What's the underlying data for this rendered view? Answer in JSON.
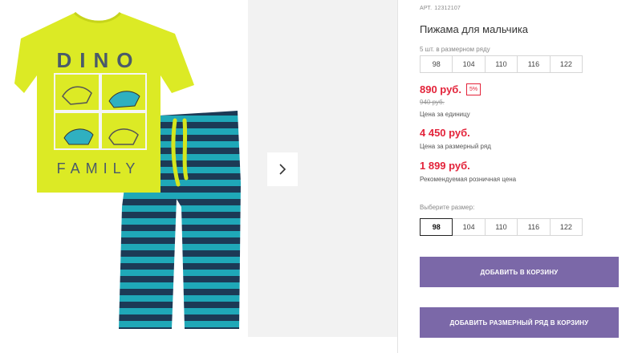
{
  "product": {
    "article_label": "АРТ.",
    "article": "12312107",
    "title": "Пижама для мальчика"
  },
  "gallery": {
    "shirt_print_top": "DINO",
    "shirt_print_bottom": "FAMILY",
    "next_icon": "chevron-right-icon",
    "shirt_color": "#dcea25",
    "stripe_dark": "#1c3a56",
    "stripe_light": "#1fa8b8"
  },
  "size_pack": {
    "label": "5 шт. в размерном ряду",
    "sizes": [
      "98",
      "104",
      "110",
      "116",
      "122"
    ]
  },
  "prices": {
    "unit_price": "890 руб.",
    "discount": "5%",
    "old_price": "940 руб.",
    "unit_note": "Цена за единицу",
    "row_price": "4 450 руб.",
    "row_note": "Цена за размерный ряд",
    "retail_price": "1 899 руб.",
    "retail_note": "Рекомендуемая розничная цена",
    "accent_color": "#e3233a"
  },
  "size_select": {
    "label": "Выберите размер:",
    "sizes": [
      "98",
      "104",
      "110",
      "116",
      "122"
    ],
    "selected": "98"
  },
  "actions": {
    "add_to_cart": "ДОБАВИТЬ В КОРЗИНУ",
    "add_row_to_cart": "ДОБАВИТЬ РАЗМЕРНЫЙ РЯД В КОРЗИНУ",
    "button_color": "#7b68a8"
  }
}
